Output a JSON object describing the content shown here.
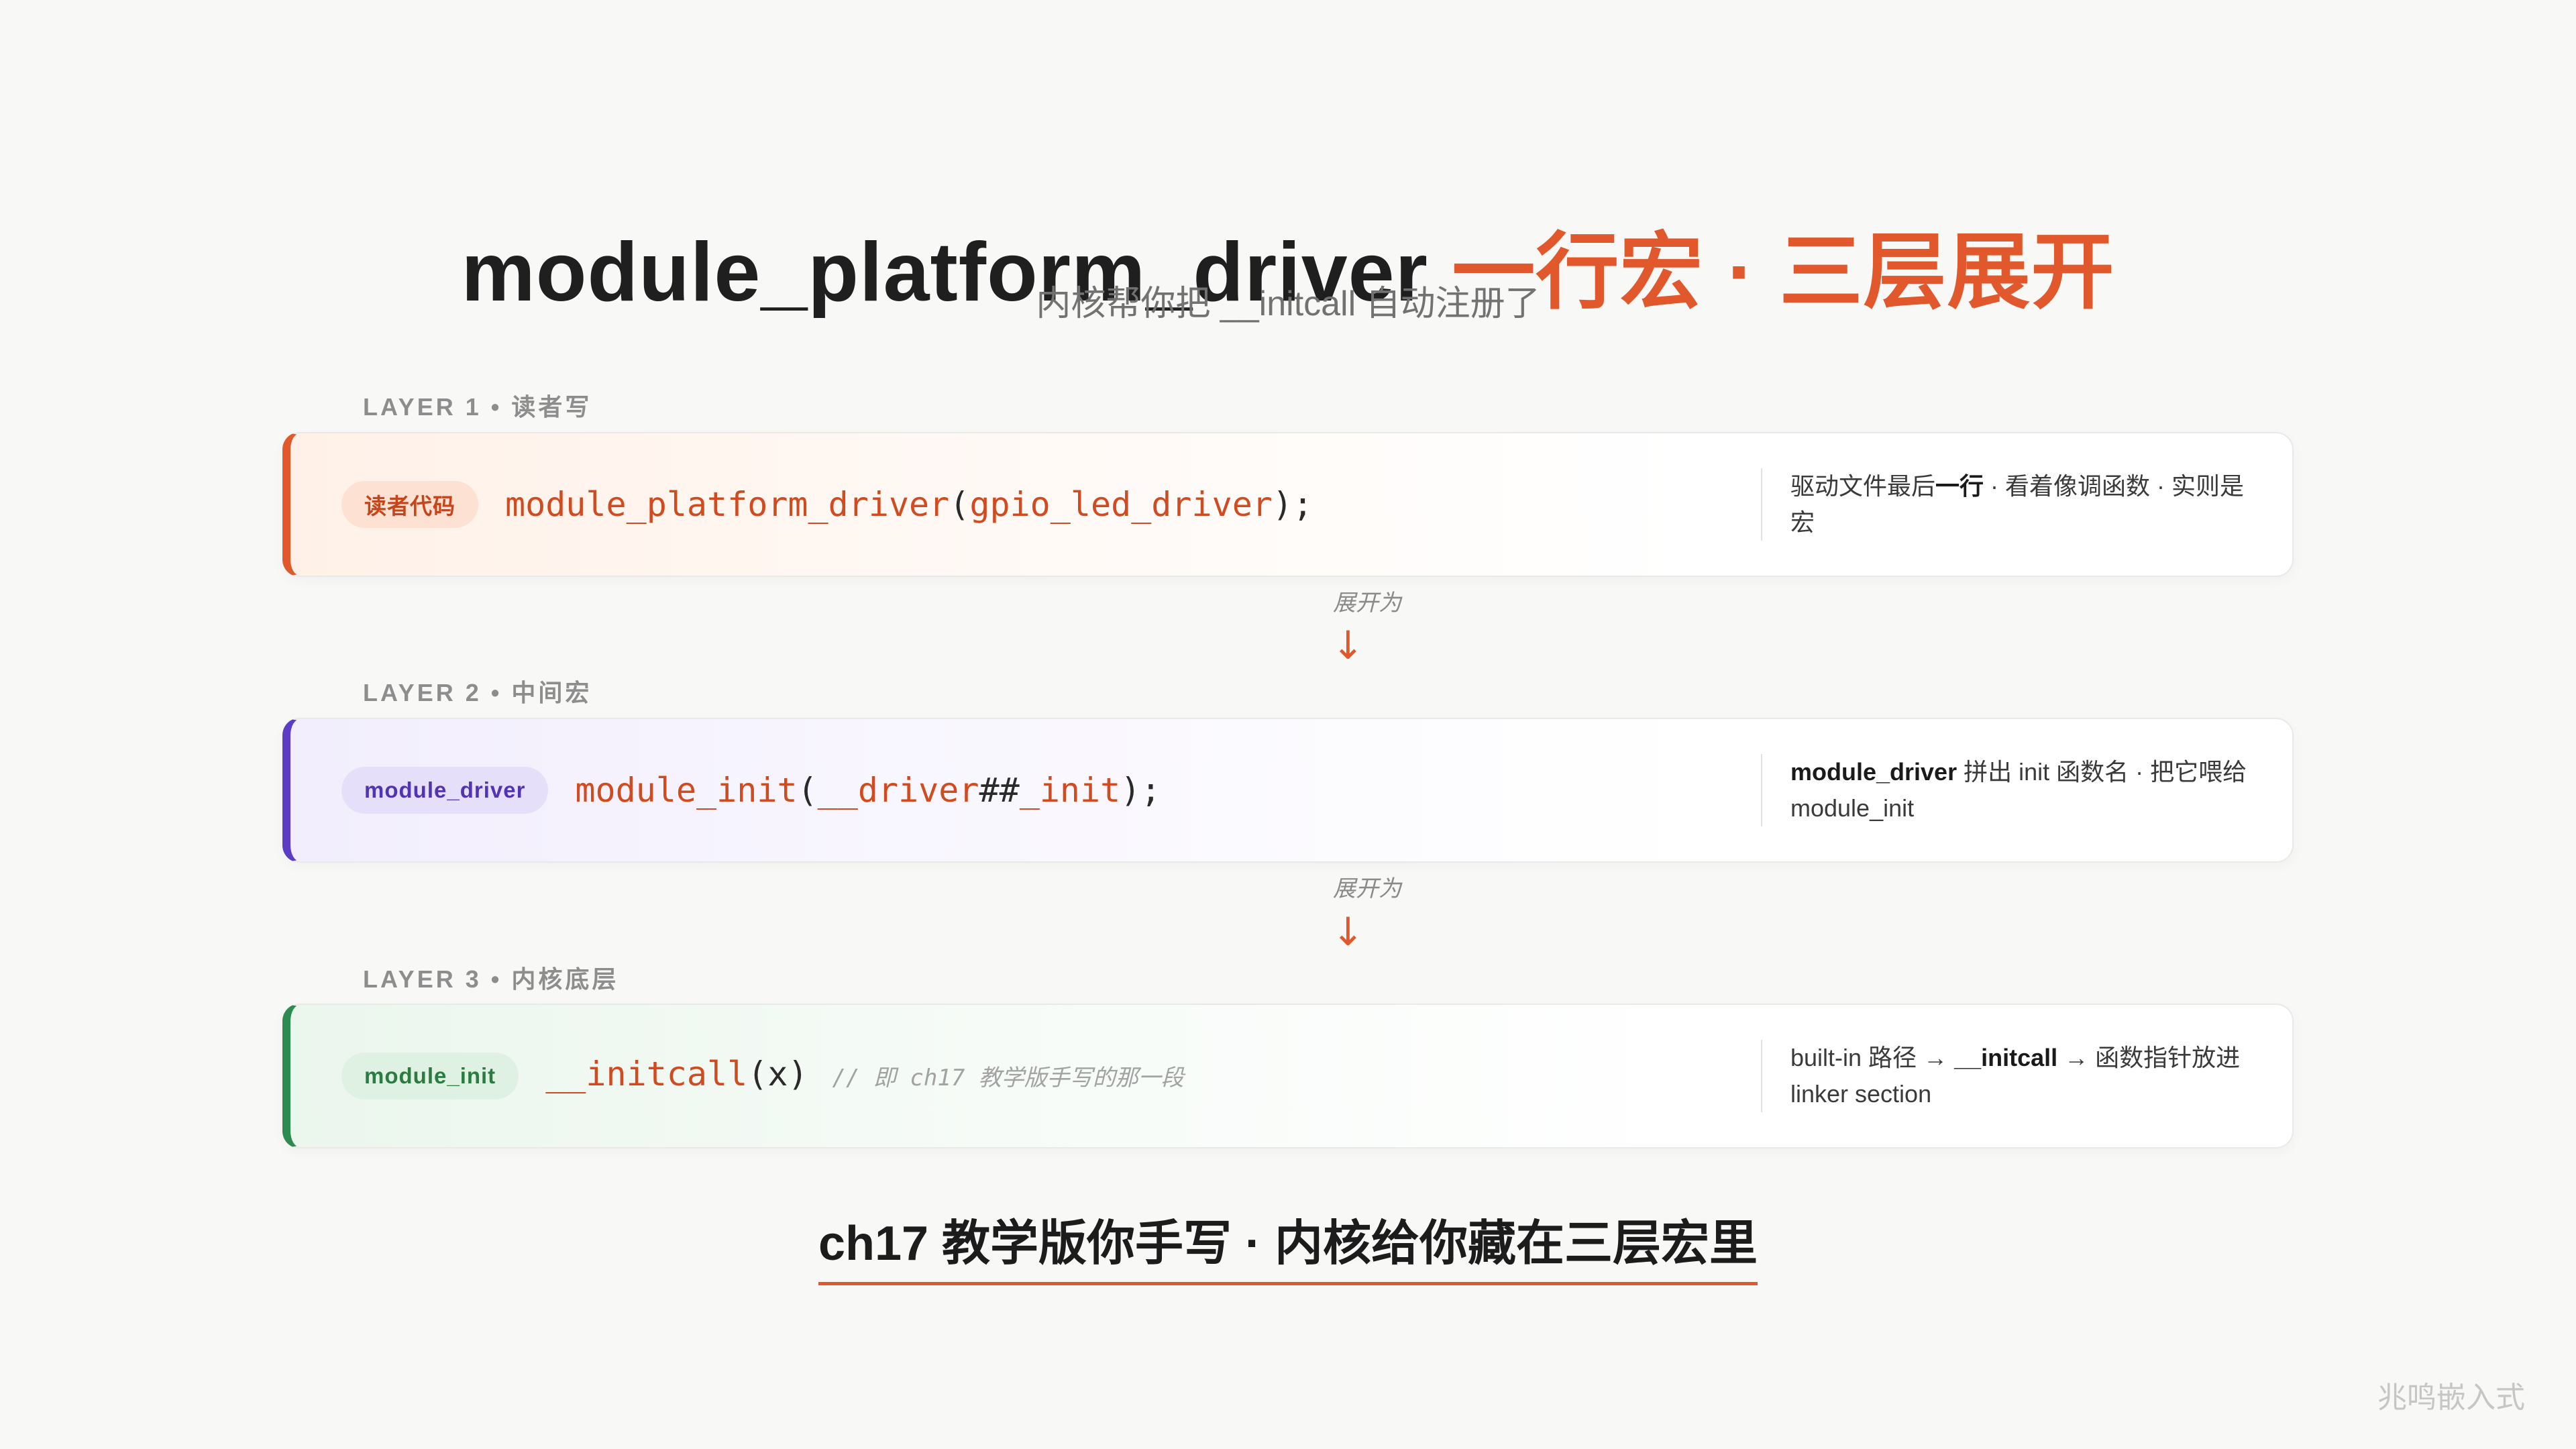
{
  "title": {
    "main": "module_platform_driver",
    "accent": "一行宏 · 三层展开"
  },
  "subtitle": "内核帮你把 __initcall 自动注册了",
  "layers": [
    {
      "label": "LAYER 1 • 读者写",
      "badge": "读者代码",
      "code": [
        "module_platform_driver",
        "(",
        "gpio_led_driver",
        ");"
      ],
      "note": [
        "驱动文件最后",
        "一行",
        " · 看着像调函数 · 实则是宏"
      ]
    },
    {
      "label": "LAYER 2 • 中间宏",
      "badge": "module_driver",
      "code": [
        "module_init",
        "(",
        "__driver",
        "##",
        "_init",
        ");"
      ],
      "note": [
        "module_driver",
        " 拼出 init 函数名 · 把它喂给 module_init"
      ]
    },
    {
      "label": "LAYER 3 • 内核底层",
      "badge": "module_init",
      "code": [
        "__initcall",
        "(x)"
      ],
      "comment": "// 即 ch17 教学版手写的那一段",
      "note": [
        "built-in 路径 → ",
        "__initcall",
        " → 函数指针放进 linker section"
      ]
    }
  ],
  "arrows": [
    {
      "text": "展开为",
      "symbol": "↓"
    },
    {
      "text": "展开为",
      "symbol": "↓"
    }
  ],
  "tagline": "ch17 教学版你手写 · 内核给你藏在三层宏里",
  "watermark": "兆鸣嵌入式",
  "colors": {
    "accent": "#e0582c",
    "layer1": "#e0582c",
    "layer2": "#5b3cc4",
    "layer3": "#2e8b4f",
    "code_highlight": "#d14b21"
  }
}
